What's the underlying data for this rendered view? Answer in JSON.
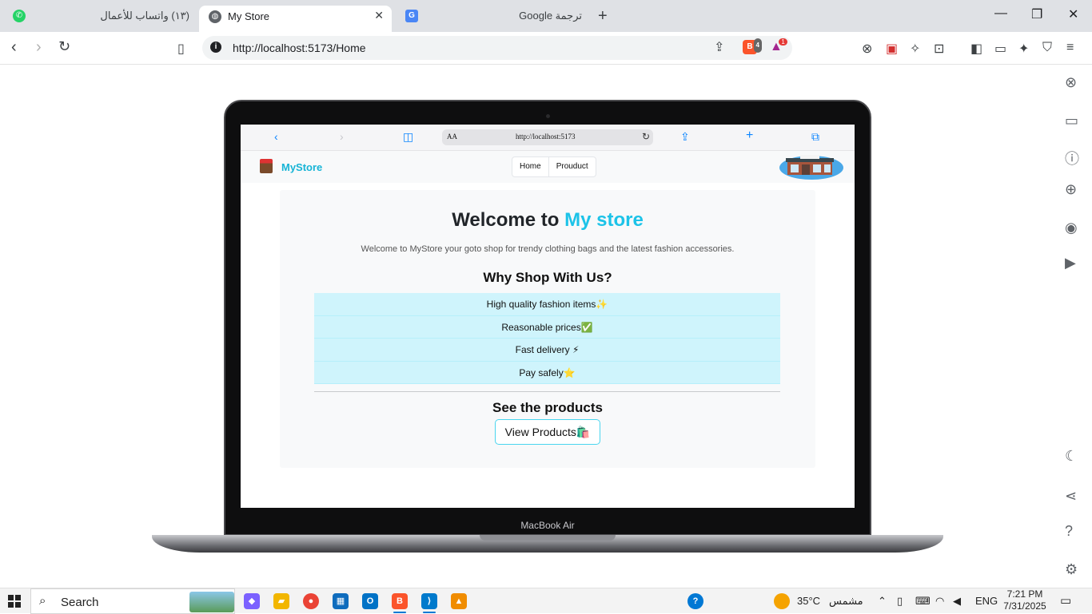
{
  "browser": {
    "tabs": [
      {
        "label": "(١٣) واتساب للأعمال",
        "icon": "whatsapp-icon"
      },
      {
        "label": "My Store",
        "icon": "globe-icon",
        "active": true
      },
      {
        "label": "ترجمة Google",
        "icon": "google-translate-icon"
      }
    ],
    "url": "http://localhost:5173/Home",
    "brave_badge": "4",
    "rewards_badge": "1"
  },
  "device": {
    "model_label": "MacBook Air",
    "safari_url": "http://localhost:5173",
    "safari_aa": "AA"
  },
  "site": {
    "brand": "MyStore",
    "nav": [
      "Home",
      "Prouduct"
    ],
    "title_prefix": "Welcome to ",
    "title_accent": "My store",
    "lead": "Welcome to MyStore your goto shop for trendy clothing bags and the latest fashion accessories.",
    "why_heading": "Why Shop With Us?",
    "features": [
      "High quality fashion items✨",
      "Reasonable prices✅",
      "Fast delivery ⚡",
      "Pay safely⭐"
    ],
    "see_heading": "See the products",
    "view_button": "View Products🛍️"
  },
  "taskbar": {
    "search": "Search",
    "temperature": "35°C",
    "weather": "مشمس",
    "language": "ENG",
    "time": "7:21 PM",
    "date": "7/31/2025"
  },
  "colors": {
    "accent": "#1cc3e8",
    "list_bg": "#cff4fc",
    "tab_bar": "#dfe1e5"
  }
}
